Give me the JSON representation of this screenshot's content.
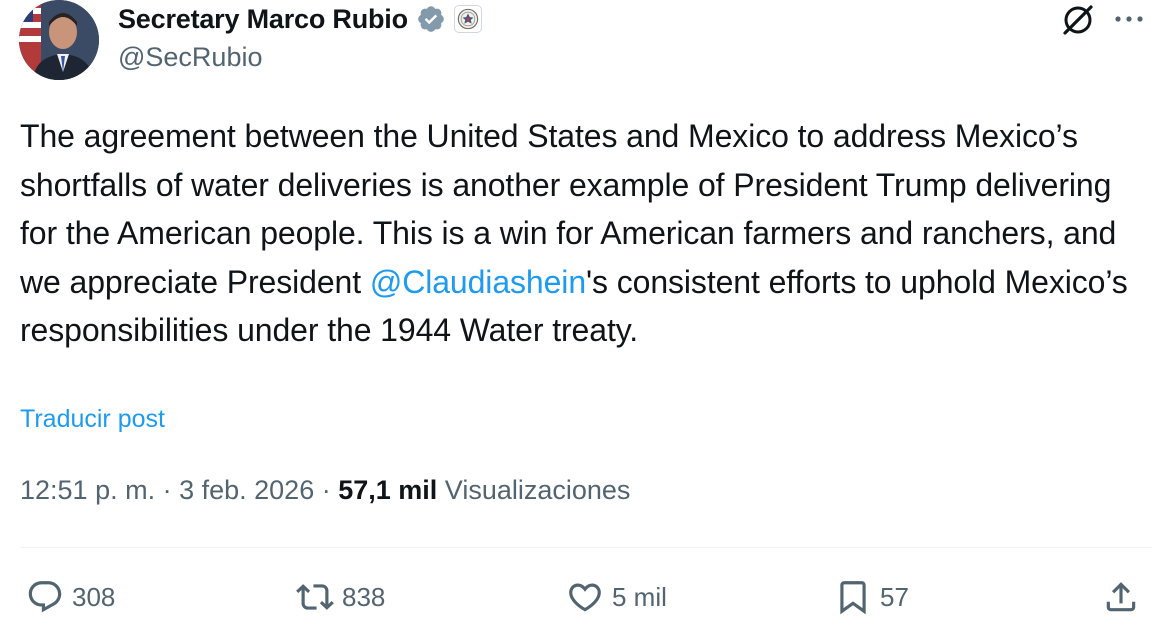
{
  "account": {
    "display_name": "Secretary Marco Rubio",
    "handle": "@SecRubio",
    "verified_badge": "verified-badge-gray",
    "affiliation_icon": "state-department-seal"
  },
  "tweet": {
    "text_before_mention": "The agreement between the United States and Mexico to address Mexico’s shortfalls of water deliveries is another example of President Trump delivering for the American people. This is a win for American farmers and ranchers, and we appreciate President ",
    "mention": "@Claudiashein",
    "text_after_mention": "'s consistent efforts to uphold Mexico’s responsibilities under the 1944 Water treaty.",
    "translate_label": "Traducir post"
  },
  "meta": {
    "time": "12:51 p. m.",
    "separator": " · ",
    "date": "3 feb. 2026",
    "views_count": "57,1 mil",
    "views_label": "Visualizaciones"
  },
  "actions": {
    "replies": "308",
    "reposts": "838",
    "likes": "5 mil",
    "bookmarks": "57"
  },
  "colors": {
    "accent": "#1d9bf0",
    "text": "#0f1419",
    "secondary": "#536471"
  }
}
